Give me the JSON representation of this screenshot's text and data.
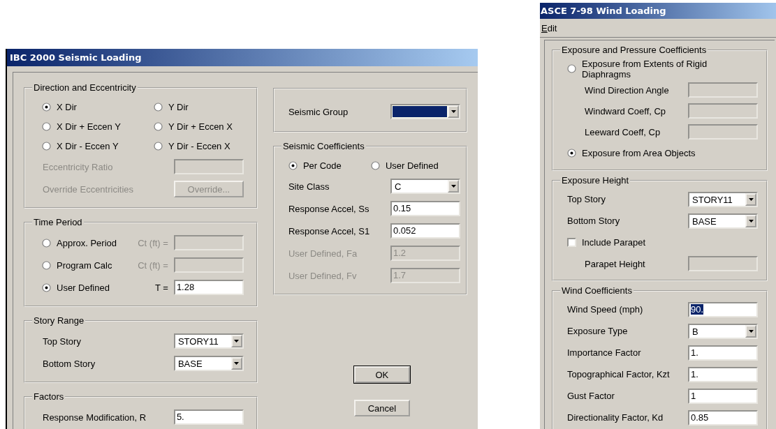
{
  "seismic_dialog": {
    "title": "IBC 2000 Seismic Loading",
    "left_groups": [
      {
        "legend": "Direction and Eccentricity",
        "rows": [
          {
            "kind": "radios",
            "items": [
              {
                "label": "X Dir",
                "selected": true
              },
              {
                "label": "Y Dir",
                "selected": false
              },
              {
                "label": "X Dir + Eccen Y",
                "selected": false
              },
              {
                "label": "Y Dir + Eccen X",
                "selected": false
              },
              {
                "label": "X Dir - Eccen Y",
                "selected": false
              },
              {
                "label": "Y Dir - Eccen X",
                "selected": false
              }
            ]
          },
          {
            "kind": "field",
            "label": "Eccentricity Ratio",
            "disabled": true,
            "label_disabled": true
          },
          {
            "kind": "button",
            "label": "Override Eccentricities",
            "button": "Override...",
            "disabled": true
          }
        ]
      },
      {
        "legend": "Time Period",
        "rows": [
          {
            "kind": "radio-field",
            "label": "Approx. Period",
            "selected": false,
            "prefix": "Ct (ft) =",
            "disabled": true
          },
          {
            "kind": "radio-field",
            "label": "Program Calc",
            "selected": false,
            "prefix": "Ct (ft) =",
            "disabled": true
          },
          {
            "kind": "radio-field",
            "label": "User Defined",
            "selected": true,
            "prefix": "T =",
            "value": "1.28",
            "disabled": false
          }
        ]
      },
      {
        "legend": "Story Range",
        "rows": [
          {
            "kind": "combo",
            "label": "Top Story",
            "value": "STORY11"
          },
          {
            "kind": "combo",
            "label": "Bottom Story",
            "value": "BASE"
          }
        ]
      },
      {
        "legend": "Factors",
        "rows": [
          {
            "kind": "field",
            "label": "Response Modification, R",
            "value": "5.",
            "disabled": false
          }
        ]
      }
    ],
    "right_groups": [
      {
        "rows": [
          {
            "kind": "combo",
            "label": "Seismic Group",
            "focused": true
          }
        ]
      },
      {
        "legend": "Seismic Coefficients",
        "rows": [
          {
            "kind": "radios",
            "items": [
              {
                "label": "Per Code",
                "selected": true
              },
              {
                "label": "User Defined",
                "selected": false
              }
            ]
          },
          {
            "kind": "combo",
            "label": "Site Class",
            "value": "C"
          },
          {
            "kind": "field",
            "label": "Response Accel,  Ss",
            "value": "0.15",
            "disabled": false
          },
          {
            "kind": "field",
            "label": "Response Accel, S1",
            "value": "0.052",
            "disabled": false
          },
          {
            "kind": "field",
            "label": "User Defined, Fa",
            "value": "1.2",
            "disabled": true,
            "label_disabled": true
          },
          {
            "kind": "field",
            "label": "User Defined, Fv",
            "value": "1.7",
            "disabled": true,
            "label_disabled": true
          }
        ]
      }
    ],
    "buttons": [
      {
        "label": "OK",
        "default": true
      },
      {
        "label": "Cancel",
        "default": false
      }
    ]
  },
  "wind_dialog": {
    "title": "ASCE 7-98 Wind Loading",
    "menu": [
      "Edit"
    ],
    "groups": [
      {
        "legend": "Exposure and Pressure Coefficients",
        "rows": [
          {
            "kind": "radio",
            "label": "Exposure from Extents of Rigid Diaphragms",
            "selected": false,
            "children": [
              {
                "kind": "field",
                "label": "Wind Direction Angle",
                "disabled": true
              },
              {
                "kind": "field",
                "label": "Windward Coeff, Cp",
                "disabled": true
              },
              {
                "kind": "field",
                "label": "Leeward Coeff, Cp",
                "disabled": true
              }
            ]
          },
          {
            "kind": "radio",
            "label": "Exposure from Area Objects",
            "selected": true
          }
        ]
      },
      {
        "legend": "Exposure Height",
        "rows": [
          {
            "kind": "combo",
            "label": "Top Story",
            "value": "STORY11"
          },
          {
            "kind": "combo",
            "label": "Bottom Story",
            "value": "BASE"
          },
          {
            "kind": "check",
            "label": "Include Parapet",
            "checked": false,
            "children": [
              {
                "kind": "field",
                "label": "Parapet Height",
                "disabled": true
              }
            ]
          }
        ]
      },
      {
        "legend": "Wind Coefficients",
        "rows": [
          {
            "kind": "field",
            "label": "Wind Speed (mph)",
            "value": "90.",
            "value_selected": true,
            "disabled": false
          },
          {
            "kind": "combo",
            "label": "Exposure Type",
            "value": "B"
          },
          {
            "kind": "field",
            "label": "Importance Factor",
            "value": "1.",
            "disabled": false
          },
          {
            "kind": "field",
            "label": "Topographical Factor, Kzt",
            "value": "1.",
            "disabled": false
          },
          {
            "kind": "field",
            "label": "Gust Factor",
            "value": "1",
            "disabled": false
          },
          {
            "kind": "field",
            "label": "Directionality Factor, Kd",
            "value": "0.85",
            "disabled": false
          }
        ]
      }
    ]
  }
}
